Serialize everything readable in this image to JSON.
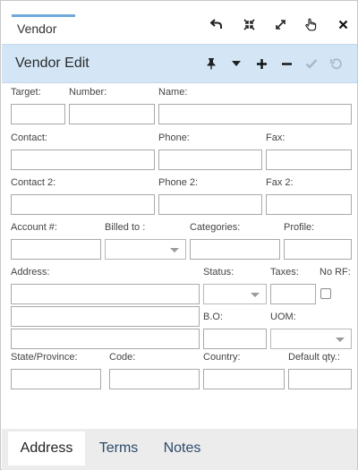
{
  "window": {
    "tab_title": "Vendor",
    "panel_title": "Vendor Edit"
  },
  "toolbar_icons": [
    "undo-arrow-icon",
    "shrink-icon",
    "expand-icon",
    "pointer-hand-icon",
    "close-icon"
  ],
  "header_icons": [
    "pin-icon",
    "chevron-down-icon",
    "plus-icon",
    "minus-icon",
    "checkmark-icon",
    "refresh-icon"
  ],
  "labels": {
    "target": "Target:",
    "number": "Number:",
    "name": "Name:",
    "contact": "Contact:",
    "phone": "Phone:",
    "fax": "Fax:",
    "contact2": "Contact 2:",
    "phone2": "Phone 2:",
    "fax2": "Fax 2:",
    "account": "Account #:",
    "billed_to": "Billed to :",
    "categories": "Categories:",
    "profile": "Profile:",
    "address": "Address:",
    "status": "Status:",
    "taxes": "Taxes:",
    "no_rf": "No RF:",
    "bo": "B.O:",
    "uom": "UOM:",
    "state": "State/Province:",
    "code": "Code:",
    "country": "Country:",
    "default_qty": "Default qty.:"
  },
  "values": {
    "target": "",
    "number": "",
    "name": "",
    "contact": "",
    "phone": "",
    "fax": "",
    "contact2": "",
    "phone2": "",
    "fax2": "",
    "account": "",
    "billed_to": "",
    "categories": "",
    "profile": "",
    "address1": "",
    "address2": "",
    "address3": "",
    "status": "",
    "taxes": "",
    "bo": "",
    "uom": "",
    "state": "",
    "code": "",
    "country": "",
    "default_qty": ""
  },
  "no_rf_checked": false,
  "tabs": [
    "Address",
    "Terms",
    "Notes"
  ],
  "active_tab": "Address"
}
